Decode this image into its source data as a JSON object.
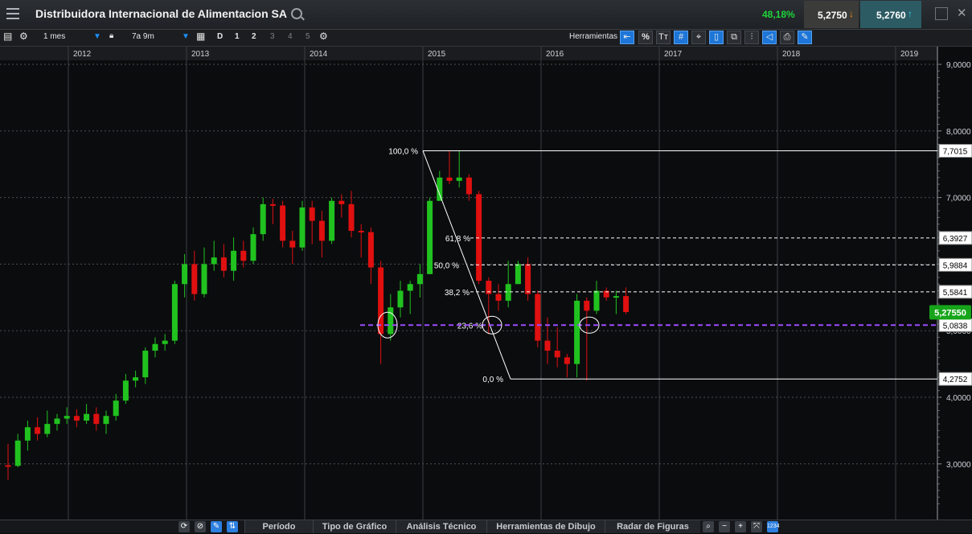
{
  "header": {
    "title": "Distribuidora Internacional de Alimentacion SA",
    "change": "48,18%",
    "sell_price": "5,2750",
    "buy_price": "5,2760"
  },
  "toolbar": {
    "period": "1 mes",
    "range": "7a 9m",
    "d_label": "D",
    "n1": "1",
    "n2": "2",
    "n3": "3",
    "n4": "4",
    "n5": "5",
    "tools_label": "Herramientas",
    "percent_btn": "%",
    "text_btn": "Tт"
  },
  "bottom": {
    "tabs": [
      "Período",
      "Tipo de Gráfico",
      "Análisis Técnico",
      "Herramientas de Dibujo",
      "Radar de Figuras"
    ]
  },
  "colors": {
    "up": "#21c21f",
    "down": "#e01010",
    "bg": "#0b0c0e",
    "grid": "#3a3f44",
    "hline": "#9a4dff",
    "last_price_bg": "#16a51a"
  },
  "chart_data": {
    "type": "candlestick",
    "instrument": "Distribuidora Internacional de Alimentacion SA",
    "interval": "1 mes",
    "x_labels": [
      "2012",
      "2013",
      "2014",
      "2015",
      "2016",
      "2017",
      "2018",
      "2019"
    ],
    "y_ticks": [
      "9,0000",
      "8,0000",
      "7,0000",
      "6,0000",
      "5,0000",
      "4,0000",
      "3,0000"
    ],
    "ylim": [
      2.35,
      9.0
    ],
    "last_price": "5,27550",
    "horizontal_line": {
      "value": 5.0838,
      "label": "5,0838"
    },
    "fibonacci": {
      "levels": [
        {
          "pct": "100,0 %",
          "value": 7.7015,
          "label": "7,7015"
        },
        {
          "pct": "61,8 %",
          "value": 6.3927,
          "label": "6,3927"
        },
        {
          "pct": "50,0 %",
          "value": 5.9884,
          "label": "5,9884"
        },
        {
          "pct": "38,2 %",
          "value": 5.5841,
          "label": "5,5841"
        },
        {
          "pct": "23,6 %",
          "value": 5.0838,
          "label": ""
        },
        {
          "pct": "0,0 %",
          "value": 4.2752,
          "label": "4,2752"
        }
      ]
    },
    "candles": [
      [
        2.98,
        2.97,
        3.3,
        2.76
      ],
      [
        2.97,
        3.35,
        3.45,
        2.95
      ],
      [
        3.35,
        3.55,
        3.65,
        3.2
      ],
      [
        3.55,
        3.45,
        3.7,
        3.35
      ],
      [
        3.45,
        3.6,
        3.8,
        3.4
      ],
      [
        3.6,
        3.68,
        3.75,
        3.5
      ],
      [
        3.68,
        3.72,
        3.85,
        3.6
      ],
      [
        3.72,
        3.65,
        3.82,
        3.55
      ],
      [
        3.65,
        3.75,
        3.9,
        3.6
      ],
      [
        3.75,
        3.6,
        3.85,
        3.5
      ],
      [
        3.6,
        3.72,
        3.8,
        3.45
      ],
      [
        3.72,
        3.95,
        4.05,
        3.65
      ],
      [
        3.95,
        4.25,
        4.35,
        3.9
      ],
      [
        4.25,
        4.3,
        4.4,
        4.15
      ],
      [
        4.3,
        4.7,
        4.75,
        4.2
      ],
      [
        4.7,
        4.8,
        4.9,
        4.6
      ],
      [
        4.8,
        4.85,
        4.95,
        4.7
      ],
      [
        4.85,
        5.7,
        5.75,
        4.8
      ],
      [
        5.7,
        6.0,
        6.15,
        5.5
      ],
      [
        6.0,
        5.55,
        6.2,
        5.45
      ],
      [
        5.55,
        6.0,
        6.25,
        5.5
      ],
      [
        6.0,
        6.1,
        6.35,
        5.9
      ],
      [
        6.1,
        5.9,
        6.3,
        5.8
      ],
      [
        5.9,
        6.2,
        6.4,
        5.75
      ],
      [
        6.2,
        6.05,
        6.35,
        5.95
      ],
      [
        6.05,
        6.45,
        6.55,
        6.0
      ],
      [
        6.45,
        6.9,
        7.0,
        6.35
      ],
      [
        6.9,
        6.88,
        6.98,
        6.6
      ],
      [
        6.88,
        6.35,
        6.95,
        6.25
      ],
      [
        6.35,
        6.25,
        6.5,
        6.0
      ],
      [
        6.25,
        6.85,
        6.95,
        6.2
      ],
      [
        6.85,
        6.65,
        6.95,
        6.3
      ],
      [
        6.65,
        6.35,
        6.8,
        6.1
      ],
      [
        6.35,
        6.95,
        7.0,
        6.3
      ],
      [
        6.95,
        6.9,
        7.05,
        6.7
      ],
      [
        6.9,
        6.5,
        7.1,
        6.4
      ],
      [
        6.5,
        6.48,
        6.6,
        6.1
      ],
      [
        6.48,
        5.95,
        6.55,
        5.7
      ],
      [
        5.95,
        4.95,
        6.05,
        4.5
      ],
      [
        4.95,
        5.35,
        5.55,
        4.85
      ],
      [
        5.35,
        5.6,
        5.75,
        5.2
      ],
      [
        5.6,
        5.7,
        5.75,
        5.25
      ],
      [
        5.7,
        5.85,
        6.0,
        5.5
      ],
      [
        5.85,
        6.95,
        7.0,
        5.85
      ],
      [
        6.95,
        7.3,
        7.4,
        6.95
      ],
      [
        7.3,
        7.25,
        7.7,
        7.2
      ],
      [
        7.25,
        7.3,
        7.7,
        7.15
      ],
      [
        7.3,
        7.05,
        7.35,
        6.95
      ],
      [
        7.05,
        5.75,
        7.1,
        5.7
      ],
      [
        5.75,
        5.55,
        5.8,
        4.95
      ],
      [
        5.55,
        5.45,
        5.7,
        5.3
      ],
      [
        5.45,
        5.7,
        6.05,
        5.35
      ],
      [
        5.7,
        6.0,
        6.05,
        5.75
      ],
      [
        6.0,
        5.55,
        6.1,
        5.45
      ],
      [
        5.55,
        4.85,
        5.6,
        4.75
      ],
      [
        4.85,
        4.7,
        5.2,
        4.5
      ],
      [
        4.7,
        4.6,
        5.05,
        4.45
      ],
      [
        4.6,
        4.5,
        4.65,
        4.3
      ],
      [
        4.5,
        5.45,
        5.55,
        4.3
      ],
      [
        5.45,
        5.3,
        5.5,
        4.25
      ],
      [
        5.3,
        5.6,
        5.75,
        5.25
      ],
      [
        5.6,
        5.5,
        5.65,
        5.45
      ],
      [
        5.5,
        5.52,
        5.6,
        5.25
      ],
      [
        5.52,
        5.28,
        5.65,
        5.25
      ]
    ]
  }
}
